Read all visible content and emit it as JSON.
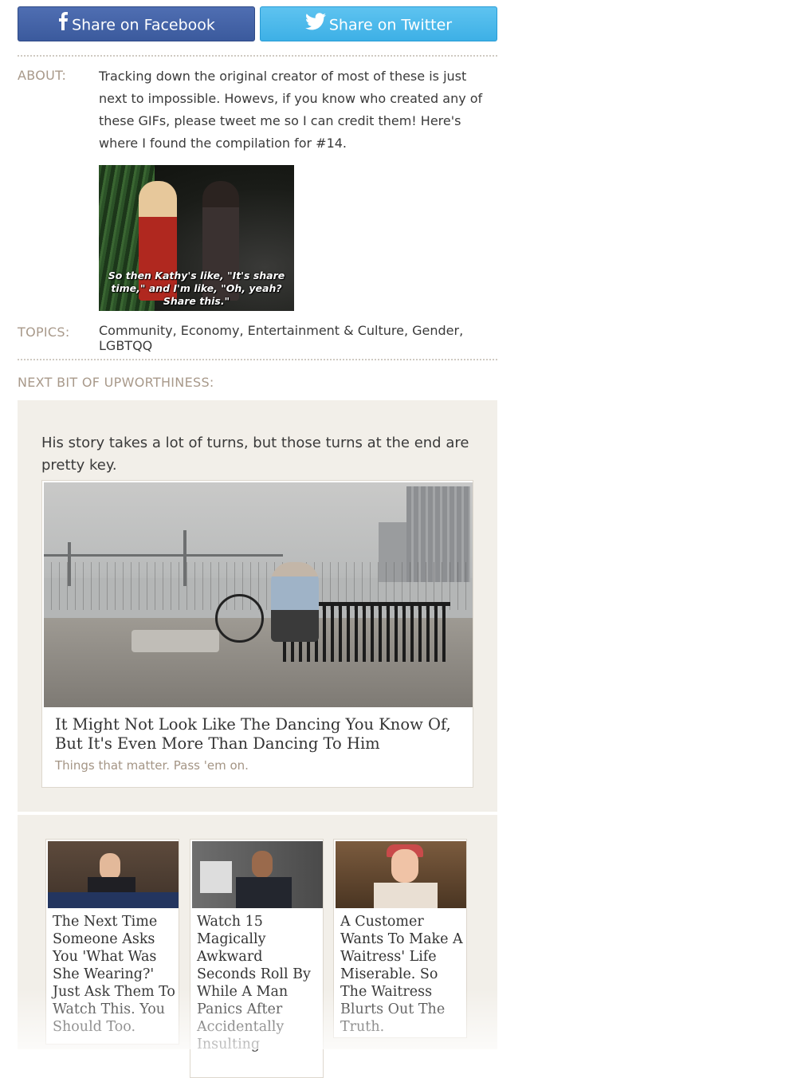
{
  "share": {
    "facebook_label": "Share on Facebook",
    "twitter_label": "Share on Twitter",
    "facebook_color": "#3b5a9d",
    "twitter_color": "#3db0e6"
  },
  "about": {
    "label": "ABOUT:",
    "text": "Tracking down the original creator of most of these is just next to impossible. Howevs, if you know who created any of these GIFs, please tweet me so I can credit them! Here's where I found the compilation for #14.",
    "gif_caption": "So then Kathy's like, \"It's share time,\" and I'm like, \"Oh, yeah? Share this.\""
  },
  "topics": {
    "label": "TOPICS:",
    "text": "Community, Economy, Entertainment & Culture, Gender, LGBTQQ"
  },
  "next": {
    "label": "NEXT BIT OF UPWORTHINESS:",
    "teaser": "His story takes a lot of turns, but those turns at the end are pretty key.",
    "title": "It Might Not Look Like The Dancing You Know Of, But It's Even More Than Dancing To Him",
    "subtitle": "Things that matter. Pass 'em on."
  },
  "recommended": [
    {
      "title": "The Next Time Someone Asks You 'What Was She Wearing?' Just Ask Them To Watch This. You Should Too."
    },
    {
      "title": "Watch 15 Magically Awkward Seconds Roll By While A Man Panics After Accidentally Insulting"
    },
    {
      "title": "A Customer Wants To Make A Waitress' Life Miserable. So The Waitress Blurts Out The Truth."
    }
  ],
  "colors": {
    "label_tan": "#a8998a",
    "panel_bg": "#f2efe9"
  }
}
